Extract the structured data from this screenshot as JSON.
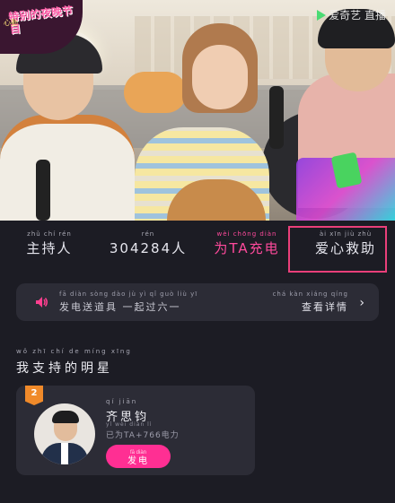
{
  "video": {
    "logo_text": "特别的夜晚节目",
    "logo_sub": "心動",
    "watermark": "爱奇艺 直播"
  },
  "stats": [
    {
      "pinyin": "zhǔ chí rén",
      "value": "主持人"
    },
    {
      "pinyin": "rén",
      "value": "304284人"
    },
    {
      "pinyin": "wèi   chōng diàn",
      "value": "为TA充电"
    },
    {
      "pinyin": "ài   xīn  jiù  zhù",
      "value": "爱心救助"
    }
  ],
  "banner": {
    "pinyin": "fā diàn sòng dào jù   yì  qǐ  guò liù  yī",
    "text": "发电送道具 一起过六一",
    "detail_pinyin": "chá kàn xiáng qíng",
    "detail_text": "查看详情",
    "chevron": "›"
  },
  "section": {
    "pinyin": "wǒ  zhī  chí  de  míng xīng",
    "title": "我支持的明星"
  },
  "star_card": {
    "rank": "2",
    "name_pinyin": "qí   jiān",
    "name": "齐思钧",
    "power_pinyin": "yǐ  wèi         diàn  lì",
    "power": "已为TA+766电力",
    "charge_pinyin": "fā diàn",
    "charge_label": "发电"
  },
  "colors": {
    "background": "#1c1c24",
    "accent_pink": "#ff2f93",
    "highlight_border": "#ea3f7a",
    "rank_badge": "#f08a2a"
  },
  "icons": {
    "speaker": "speaker-icon",
    "chevron": "chevron-right-icon"
  }
}
